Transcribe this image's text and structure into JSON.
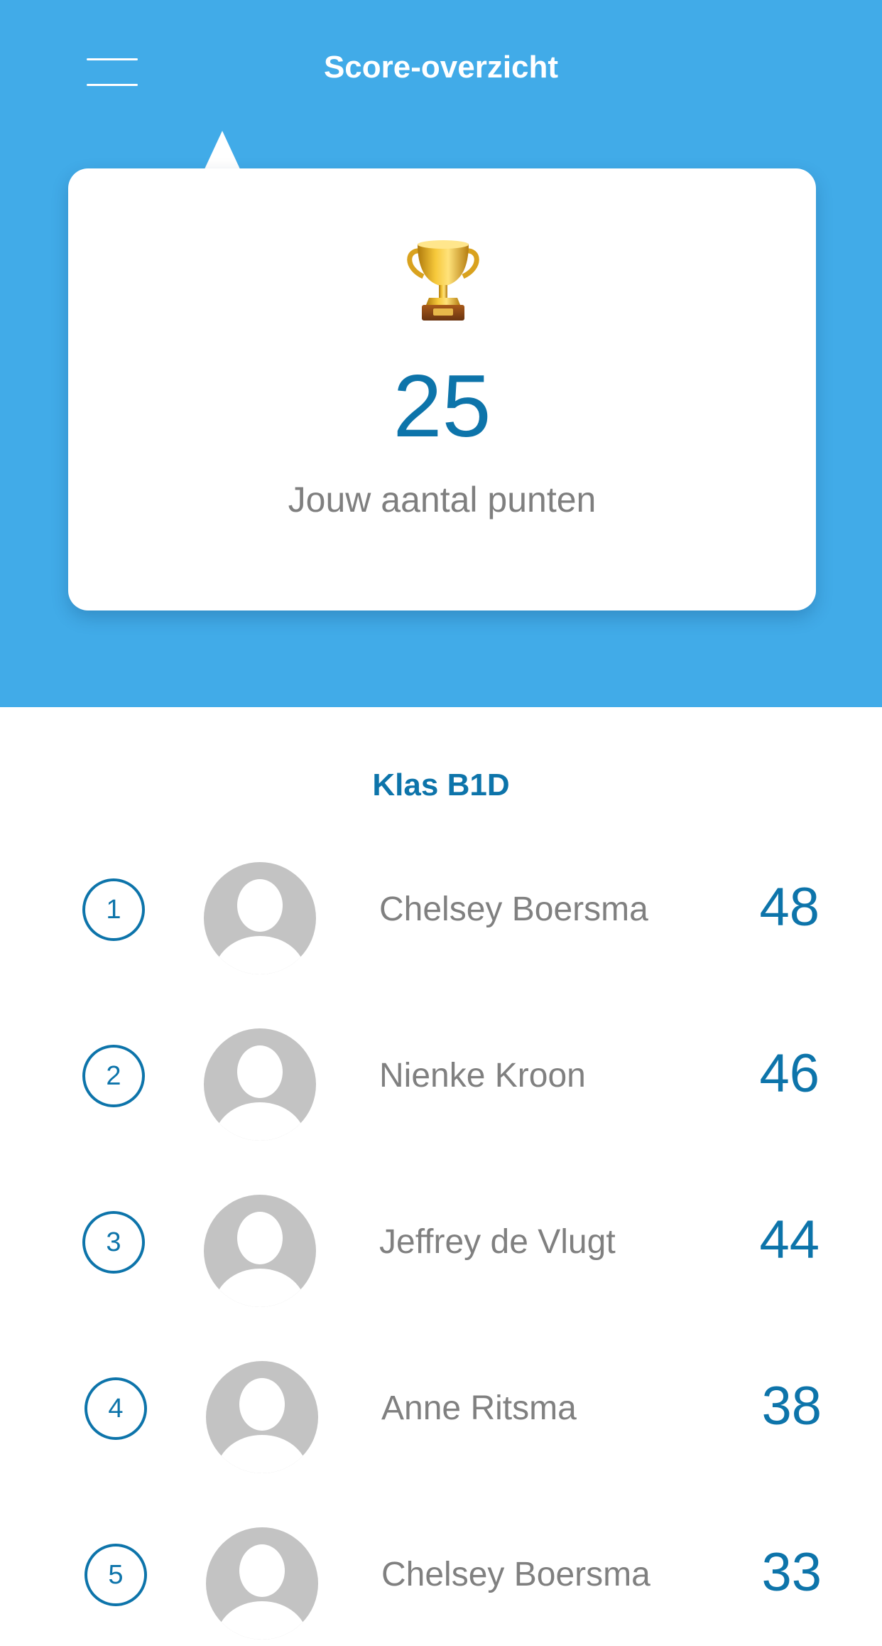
{
  "header": {
    "title": "Score-overzicht",
    "menu_icon": "hamburger-menu-icon"
  },
  "score_card": {
    "icon": "trophy-icon",
    "points": "25",
    "label": "Jouw aantal punten"
  },
  "leaderboard": {
    "class_name": "Klas B1D",
    "rows": [
      {
        "rank": "1",
        "name": "Chelsey Boersma",
        "score": "48"
      },
      {
        "rank": "2",
        "name": "Nienke Kroon",
        "score": "46"
      },
      {
        "rank": "3",
        "name": "Jeffrey de Vlugt",
        "score": "44"
      },
      {
        "rank": "4",
        "name": "Anne Ritsma",
        "score": "38"
      },
      {
        "rank": "5",
        "name": "Chelsey Boersma",
        "score": "33"
      }
    ]
  },
  "colors": {
    "header_blue": "#41abe8",
    "accent_blue": "#0d74aa",
    "avatar_gray": "#c3c3c3",
    "text_gray": "#808080"
  }
}
